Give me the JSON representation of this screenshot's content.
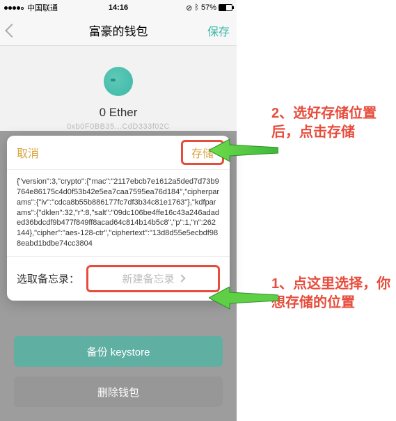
{
  "status": {
    "carrier": "中国联通",
    "time": "14:16",
    "battery_pct": "57%"
  },
  "nav": {
    "title": "富豪的钱包",
    "save": "保存"
  },
  "wallet": {
    "balance": "0 Ether",
    "address": "0xb0F0BB35...CdD333f02C"
  },
  "sheet": {
    "cancel": "取消",
    "store": "存储",
    "body": "{\"version\":3,\"crypto\":{\"mac\":\"2117ebcb7e1612a5ded7d73b9764e86175c4d0f53b42e5ea7caa7595ea76d184\",\"cipherparams\":{\"iv\":\"cdca8b55b886177fc7df3b34c81e1763\"},\"kdfparams\":{\"dklen\":32,\"r\":8,\"salt\":\"09dc106be4ffe16c43a246adaded36bdcdf9b477f849ff8acad64c814b14b5c8\",\"p\":1,\"n\":262144},\"cipher\":\"aes-128-ctr\",\"ciphertext\":\"13d8d55e5ecbdf988eabd1bdbe74cc3804",
    "footer_label": "选取备忘录：",
    "memo_btn": "新建备忘录"
  },
  "buttons": {
    "backup": "备份 keystore",
    "delete": "删除钱包"
  },
  "annotations": {
    "a2": "2、选好存储位置后，点击存储",
    "a1": "1、点这里选择，你想存储的位置"
  }
}
